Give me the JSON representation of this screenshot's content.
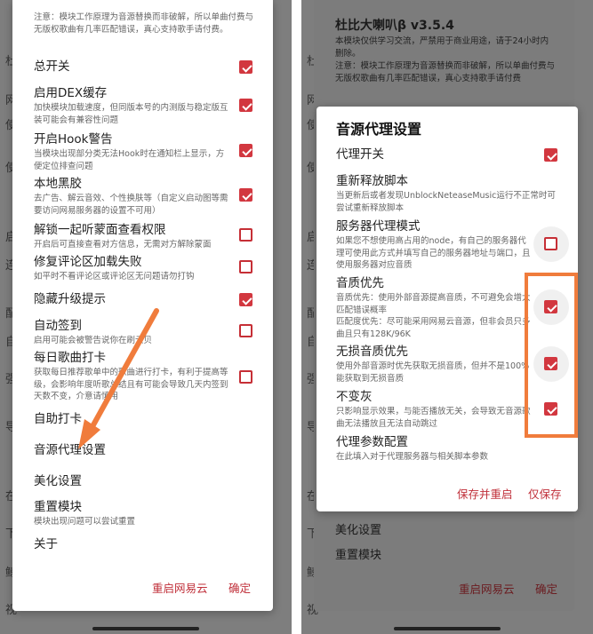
{
  "colors": {
    "accent": "#d2373f",
    "annotation": "#f07c3c",
    "scrim": "#7e7e7e"
  },
  "left": {
    "bg": {
      "r1": "杜",
      "r2": "网",
      "r3": "使",
      "r4": "使",
      "r5": "启",
      "r6": "连",
      "r7": "配",
      "r8": "自",
      "r9": "强",
      "r10": "导",
      "r11": "在",
      "r12": "下",
      "r13": "鲸",
      "r14": "视"
    },
    "notice": "注意：模块工作原理为音源替换而非破解，所以单曲付费与无版权歌曲有几率匹配错误，真心支持歌手请付费。",
    "items": [
      {
        "title": "总开关",
        "desc": "",
        "checked": true
      },
      {
        "title": "启用DEX缓存",
        "desc": "加快模块加载速度，但同版本号的内测版与稳定版互装可能会有兼容性问题",
        "checked": true
      },
      {
        "title": "开启Hook警告",
        "desc": "当模块出现部分类无法Hook时在通知栏上显示，方便定位排查问题",
        "checked": true
      },
      {
        "title": "本地黑胶",
        "desc": "去广告、解云音效、个性换肤等（自定义启动图等需要访问网易服务器的设置不可用）",
        "checked": true
      },
      {
        "title": "解锁一起听蒙面查看权限",
        "desc": "开启后可直接查看对方信息，无需对方解除蒙面",
        "checked": false
      },
      {
        "title": "修复评论区加载失败",
        "desc": "如平时不看评论区或评论区无问题请勿打钩",
        "checked": false
      },
      {
        "title": "隐藏升级提示",
        "desc": "",
        "checked": true
      },
      {
        "title": "自动签到",
        "desc": "启用可能会被警告说你在刷云贝",
        "checked": false
      },
      {
        "title": "每日歌曲打卡",
        "desc": "获取每日推荐歌单中的歌曲进行打卡，有利于提高等级，会影响年度听歌总结且有可能会导致几天内签到天数不变，介意请慎用",
        "checked": false
      }
    ],
    "menu": [
      {
        "title": "自助打卡",
        "desc": ""
      },
      {
        "title": "音源代理设置",
        "desc": ""
      },
      {
        "title": "美化设置",
        "desc": ""
      },
      {
        "title": "重置模块",
        "desc": "模块出现问题可以尝试重置"
      },
      {
        "title": "关于",
        "desc": ""
      }
    ],
    "buttons": {
      "restart": "重启网易云",
      "ok": "确定"
    }
  },
  "right": {
    "bg": {
      "r1": "杜",
      "r2": "网",
      "r3": "使",
      "r4": "使",
      "r5": "启",
      "r6": "连",
      "r7": "配",
      "r8": "自",
      "r9": "强",
      "r10": "导",
      "r11": "在",
      "r12": "下",
      "r13": "鲸",
      "r14": "视"
    },
    "header": {
      "title": "杜比大喇叭β v3.5.4",
      "desc": "本模块仅供学习交流，严禁用于商业用途，请于24小时内删除。",
      "notice": "注意：模块工作原理为音源替换而非破解，所以单曲付费与无版权歌曲有几率匹配错误，真心支持歌手请付费"
    },
    "behind": {
      "item1": "美化设置",
      "item2": "重置模块",
      "restart": "重启网易云",
      "ok": "确定"
    },
    "dialog": {
      "title": "音源代理设置",
      "items": [
        {
          "title": "代理开关",
          "desc": "",
          "checked": true
        },
        {
          "title": "重新释放脚本",
          "desc": "当更新后或者发现UnblockNeteaseMusic运行不正常时可尝试重新释放脚本",
          "checked": null
        },
        {
          "title": "服务器代理模式",
          "desc": "如果您不想使用高占用的node，有自己的服务器代理可使用此方式并填写自己的服务器地址与端口，且使用服务器对应音质",
          "checked": false
        },
        {
          "title": "音质优先",
          "desc": "音质优先：使用外部音源提高音质，不可避免会增大匹配错误概率\n匹配度优先：尽可能采用网易云音源，但非会员只多曲且只有128K/96K",
          "checked": true
        },
        {
          "title": "无损音质优先",
          "desc": "使用外部音源时优先获取无损音质，但并不是100%能获取到无损音质",
          "checked": true
        },
        {
          "title": "不变灰",
          "desc": "只影响显示效果，与能否播放无关，会导致无音源歌曲无法播放且无法自动跳过",
          "checked": true
        },
        {
          "title": "代理参数配置",
          "desc": "在此填入对于代理服务器与相关脚本参数",
          "checked": null
        }
      ],
      "buttons": {
        "save_restart": "保存并重启",
        "save": "仅保存"
      }
    }
  }
}
